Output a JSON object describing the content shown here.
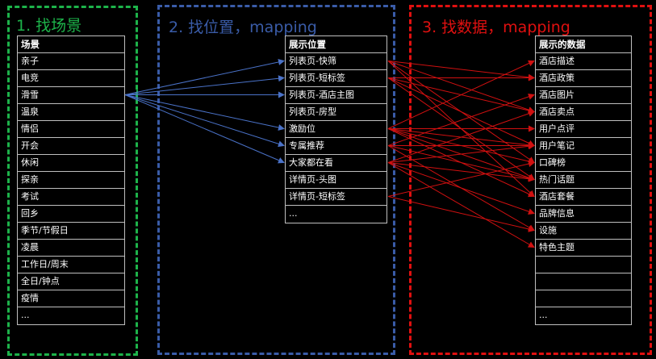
{
  "panels": [
    {
      "title": "1. 找场景",
      "color": "#1db34a"
    },
    {
      "title": "2. 找位置，mapping",
      "color": "#3a5ca8"
    },
    {
      "title": "3. 找数据，mapping",
      "color": "#e01010"
    }
  ],
  "scenes": {
    "header": "场景",
    "items": [
      "亲子",
      "电竞",
      "滑雪",
      "温泉",
      "情侣",
      "开会",
      "休闲",
      "探亲",
      "考试",
      "回乡",
      "季节/节假日",
      "凌晨",
      "工作日/周末",
      "全日/钟点",
      "疫情",
      "..."
    ]
  },
  "positions": {
    "header": "展示位置",
    "items": [
      "列表页-快筛",
      "列表页-短标签",
      "列表页-酒店主图",
      "列表页-房型",
      "激励位",
      "专属推荐",
      "大家都在看",
      "详情页-头图",
      "详情页-短标签",
      "..."
    ]
  },
  "data_items": {
    "header": "展示的数据",
    "items": [
      "酒店描述",
      "酒店政策",
      "酒店图片",
      "酒店卖点",
      "用户点评",
      "用户笔记",
      "口碑榜",
      "热门话题",
      "酒店套餐",
      "品牌信息",
      "设施",
      "特色主题",
      "",
      "",
      "",
      "..."
    ]
  },
  "link_colors": {
    "scene_to_position": "#4a72c8",
    "position_to_data": "#d01010"
  },
  "scene_links": {
    "from": 2,
    "to": [
      0,
      1,
      2,
      4,
      5,
      6
    ]
  },
  "data_links": [
    [
      0,
      1
    ],
    [
      0,
      3
    ],
    [
      0,
      6
    ],
    [
      0,
      8
    ],
    [
      1,
      1
    ],
    [
      1,
      3
    ],
    [
      1,
      5
    ],
    [
      1,
      7
    ],
    [
      4,
      0
    ],
    [
      4,
      4
    ],
    [
      4,
      5
    ],
    [
      4,
      6
    ],
    [
      4,
      7
    ],
    [
      4,
      8
    ],
    [
      5,
      2
    ],
    [
      5,
      5
    ],
    [
      5,
      7
    ],
    [
      5,
      10
    ],
    [
      6,
      3
    ],
    [
      6,
      5
    ],
    [
      6,
      7
    ],
    [
      6,
      9
    ],
    [
      6,
      11
    ],
    [
      8,
      6
    ],
    [
      8,
      10
    ]
  ]
}
